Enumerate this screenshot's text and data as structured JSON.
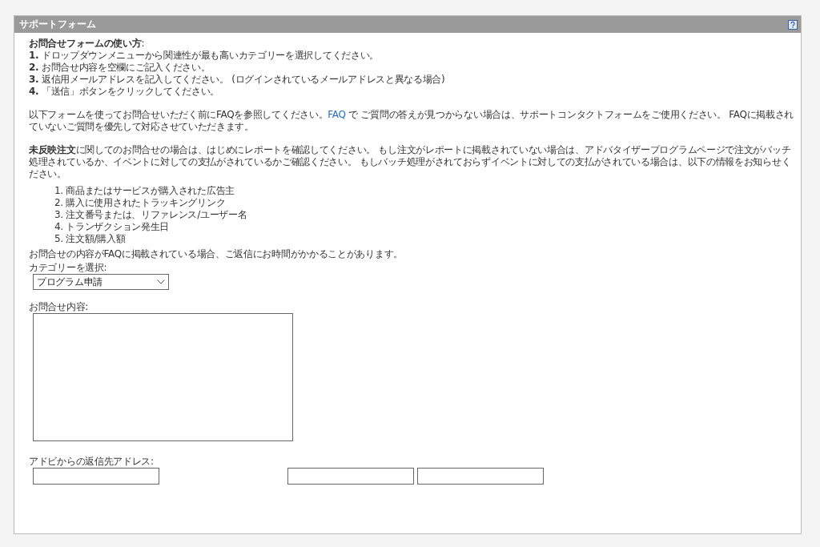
{
  "panel": {
    "title": "サポートフォーム"
  },
  "instructions": {
    "heading": "**お問合せフォームの使い方**:",
    "steps": [
      {
        "number": "1.",
        "text": "ドロップダウンメニューから関連性が最も高いカテゴリーを選択してください。"
      },
      {
        "number": "2.",
        "text": "お問合せ内容を空欄にご記入ください。"
      },
      {
        "number": "3.",
        "text": "返信用メールアドレスを記入してください。 (ログインされているメールアドレスと異なる場合)"
      },
      {
        "number": "4.",
        "text": "「送信」ボタンをクリックしてください。"
      }
    ]
  },
  "faq_paragraph": {
    "before": "以下フォームを使ってお問合せいただく前にFAQを参照してください。",
    "link": "FAQ",
    "after": " で ご質問の答えが見つからない場合は、サポートコンタクトフォームをご使用ください。 FAQに掲載されていないご質問を優先して対応させていただきます。"
  },
  "order_paragraph": "**未反映注文**に関してのお問合せの場合は、はじめにレポートを確認してください。 もし注文がレポートに掲載されていない場合は、アドバタイザープログラムページで注文がバッチ処理されているか、イベントに対しての支払がされているかご確認ください。 もしバッチ処理がされておらずイベントに対しての支払がされている場合は、以下の情報をお知らせください。",
  "info_list": [
    {
      "number": "1.",
      "text": "商品またはサービスが購入された広告主"
    },
    {
      "number": "2.",
      "text": "購入に使用されたトラッキングリンク"
    },
    {
      "number": "3.",
      "text": "注文番号または、リファレンス/ユーザー名"
    },
    {
      "number": "4.",
      "text": "トランザクション発生日"
    },
    {
      "number": "5.",
      "text": "注文額/購入額"
    }
  ],
  "note": "お問合せの内容がFAQに掲載されている場合、ご返信にお時間がかかることがあります。",
  "category": {
    "label": "カテゴリーを選択:",
    "value": "プログラム申請"
  },
  "message": {
    "label": "お問合せ内容:"
  },
  "reply_address": {
    "label": "アドビからの返信先アドレス:"
  }
}
